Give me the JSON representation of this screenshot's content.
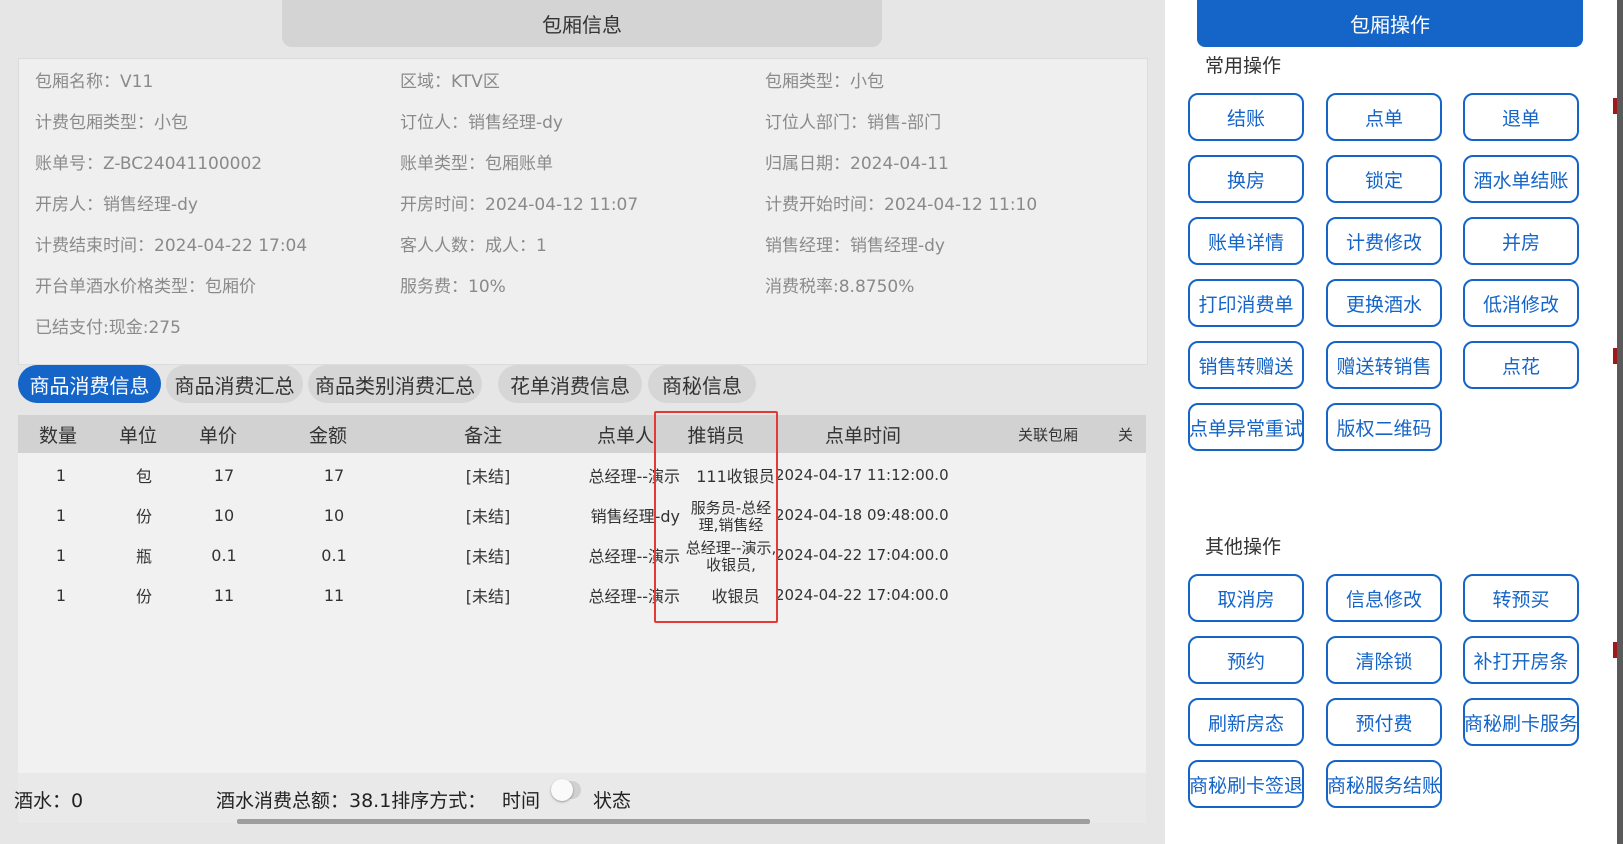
{
  "header": {
    "title": "包厢信息"
  },
  "info": [
    [
      "包厢名称：V11",
      "区域：KTV区",
      "包厢类型：小包"
    ],
    [
      "计费包厢类型：小包",
      "订位人：销售经理-dy",
      "订位人部门：销售-部门"
    ],
    [
      "账单号：Z-BC24041100002",
      "账单类型：包厢账单",
      "归属日期：2024-04-11"
    ],
    [
      "开房人：销售经理-dy",
      "开房时间：2024-04-12 11:07",
      "计费开始时间：2024-04-12 11:10"
    ],
    [
      "计费结束时间：2024-04-22 17:04",
      "客人人数：成人：1",
      "销售经理：销售经理-dy"
    ],
    [
      "开台单酒水价格类型：包厢价",
      "服务费：10%",
      "消费税率:8.8750%"
    ],
    [
      "已结支付:现金:275",
      "",
      ""
    ]
  ],
  "tabs": [
    "商品消费信息",
    "商品消费汇总",
    "商品类别消费汇总",
    "花单消费信息",
    "商秘信息"
  ],
  "table": {
    "headers": [
      "数量",
      "单位",
      "单价",
      "金额",
      "备注",
      "点单人",
      "推销员",
      "点单时间",
      "关联包厢",
      "关"
    ],
    "rows": [
      [
        "1",
        "包",
        "17",
        "17",
        "[未结]",
        "总经理--演示",
        "111收银员",
        "2024-04-17 11:12:00.0"
      ],
      [
        "1",
        "份",
        "10",
        "10",
        "[未结]",
        "销售经理-dy",
        "服务员-总经理,销售经",
        "2024-04-18 09:48:00.0"
      ],
      [
        "1",
        "瓶",
        "0.1",
        "0.1",
        "[未结]",
        "总经理--演示",
        "总经理--演示,收银员,",
        "2024-04-22 17:04:00.0"
      ],
      [
        "1",
        "份",
        "11",
        "11",
        "[未结]",
        "总经理--演示",
        "收银员",
        "2024-04-22 17:04:00.0"
      ]
    ]
  },
  "footer": {
    "left_text": "酒水：0",
    "total_text": "酒水消费总额：38.1排序方式：",
    "sort_time": "时间",
    "sort_state": "状态"
  },
  "ops": {
    "title": "包厢操作",
    "common_title": "常用操作",
    "common": [
      "结账",
      "点单",
      "退单",
      "换房",
      "锁定",
      "酒水单结账",
      "账单详情",
      "计费修改",
      "并房",
      "打印消费单",
      "更换酒水",
      "低消修改",
      "销售转赠送",
      "赠送转销售",
      "点花",
      "点单异常重试",
      "版权二维码"
    ],
    "other_title": "其他操作",
    "other": [
      "取消房",
      "信息修改",
      "转预买",
      "预约",
      "清除锁",
      "补打开房条",
      "刷新房态",
      "预付费",
      "商秘刷卡服务",
      "商秘刷卡签退",
      "商秘服务结账"
    ]
  },
  "colors": {
    "accent": "#1565c8",
    "highlight_box": "#e53935"
  }
}
